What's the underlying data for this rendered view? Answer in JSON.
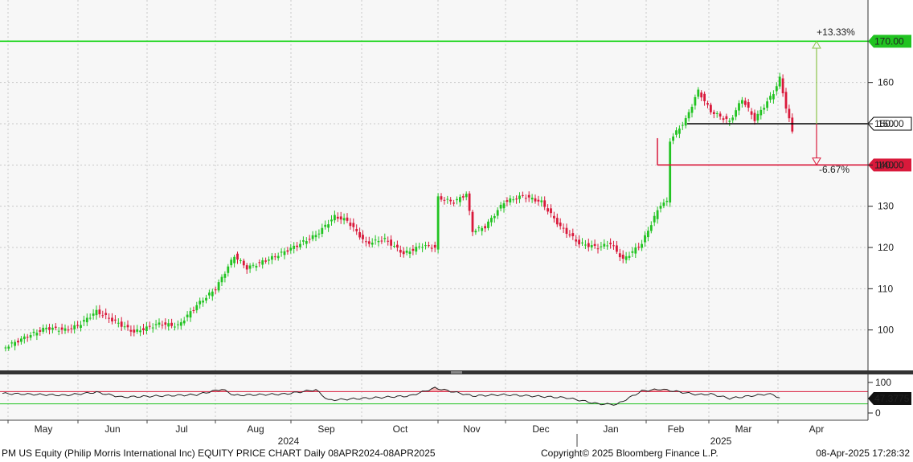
{
  "colors": {
    "up": "#22c322",
    "down": "#d9193b",
    "target_line": "#16d416",
    "support_line": "#d9193b",
    "current_line": "#000000",
    "pct_up": "#8bc34a",
    "pct_down": "#d9193b",
    "rsi_line": "#222222",
    "rsi_fill": "#f4b4b4"
  },
  "footer": {
    "left": "PM US Equity (Philip Morris International Inc) EQUITY PRICE CHART  Daily 08APR2024-08APR2025",
    "center": "Copyright© 2025 Bloomberg Finance L.P.",
    "right": "08-Apr-2025 17:28:32"
  },
  "chart_data": {
    "type": "candlestick",
    "ylim": [
      90,
      180
    ],
    "y_ticks": [
      100,
      110,
      120,
      130,
      140,
      150,
      160
    ],
    "month_labels": [
      "May",
      "Jun",
      "Jul",
      "Aug",
      "Sep",
      "Oct",
      "Nov",
      "Dec",
      "Jan",
      "Feb",
      "Mar",
      "Apr"
    ],
    "year_labels": [
      "2024",
      "2025"
    ],
    "anchors": [
      [
        0,
        95.5
      ],
      [
        8,
        98.5
      ],
      [
        14,
        100.5
      ],
      [
        20,
        100
      ],
      [
        24,
        101
      ],
      [
        30,
        104.5
      ],
      [
        36,
        102
      ],
      [
        42,
        99.5
      ],
      [
        50,
        101.5
      ],
      [
        56,
        101
      ],
      [
        62,
        106
      ],
      [
        68,
        110
      ],
      [
        74,
        118
      ],
      [
        78,
        115
      ],
      [
        86,
        117.5
      ],
      [
        94,
        120.5
      ],
      [
        100,
        123
      ],
      [
        106,
        127.5
      ],
      [
        110,
        126.5
      ],
      [
        116,
        121
      ],
      [
        122,
        122
      ],
      [
        128,
        118.5
      ],
      [
        134,
        120.5
      ],
      [
        138,
        120
      ],
      [
        139,
        132
      ],
      [
        144,
        131
      ],
      [
        148,
        133
      ],
      [
        150,
        124
      ],
      [
        154,
        125
      ],
      [
        160,
        131
      ],
      [
        166,
        132.5
      ],
      [
        172,
        131
      ],
      [
        178,
        125
      ],
      [
        184,
        121
      ],
      [
        190,
        120
      ],
      [
        194,
        121
      ],
      [
        198,
        117
      ],
      [
        204,
        121
      ],
      [
        210,
        130.5
      ],
      [
        212,
        131
      ],
      [
        213,
        146
      ],
      [
        218,
        151
      ],
      [
        222,
        158
      ],
      [
        226,
        153
      ],
      [
        232,
        150.5
      ],
      [
        236,
        156
      ],
      [
        240,
        151
      ],
      [
        246,
        157.5
      ],
      [
        248,
        161
      ],
      [
        250,
        154
      ],
      [
        252,
        148
      ]
    ],
    "levels": [
      {
        "label": "170.00",
        "value": 170,
        "pct": "+13.33%"
      },
      {
        "label": "150.00",
        "value": 150
      },
      {
        "label": "140.00",
        "value": 140,
        "pct": "-6.67%"
      }
    ],
    "rsi": {
      "ylim": [
        0,
        100
      ],
      "ticks": [
        100,
        0
      ],
      "overbought": 70,
      "oversold": 30,
      "last_label": "47.3775",
      "anchors": [
        [
          0,
          64
        ],
        [
          20,
          58
        ],
        [
          30,
          68
        ],
        [
          38,
          52
        ],
        [
          48,
          55
        ],
        [
          62,
          60
        ],
        [
          70,
          78
        ],
        [
          74,
          58
        ],
        [
          90,
          62
        ],
        [
          100,
          76
        ],
        [
          104,
          42
        ],
        [
          130,
          56
        ],
        [
          138,
          82
        ],
        [
          150,
          56
        ],
        [
          160,
          60
        ],
        [
          180,
          50
        ],
        [
          190,
          30
        ],
        [
          196,
          28
        ],
        [
          204,
          72
        ],
        [
          210,
          78
        ],
        [
          222,
          60
        ],
        [
          226,
          62
        ],
        [
          232,
          48
        ],
        [
          244,
          62
        ],
        [
          246,
          60
        ],
        [
          248,
          48
        ]
      ]
    }
  }
}
